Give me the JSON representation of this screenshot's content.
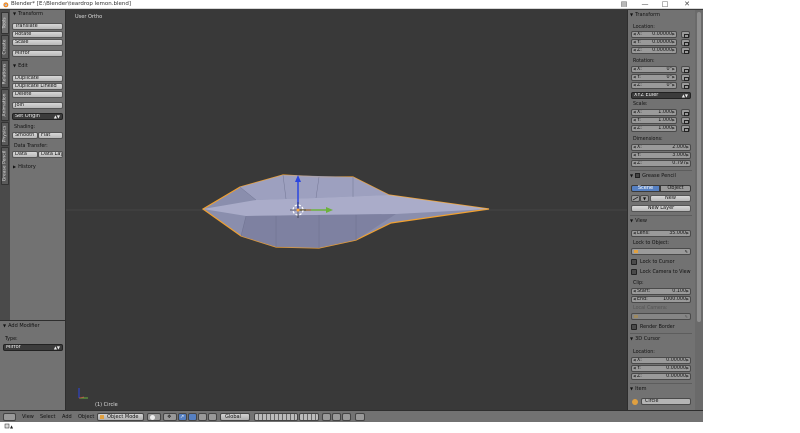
{
  "window": {
    "title": "Blender* [E:\\Blender\\teardrop lemon.blend]",
    "min_symbol": "—",
    "max_symbol": "□",
    "close_symbol": "✕"
  },
  "tool_tabs": [
    "Tools",
    "Create",
    "Relations",
    "Animation",
    "Physics",
    "Grease Pencil"
  ],
  "toolshelf": {
    "transform": {
      "title": "Transform",
      "buttons": [
        "Translate",
        "Rotate",
        "Scale",
        "Mirror"
      ]
    },
    "edit": {
      "title": "Edit",
      "buttons": [
        "Duplicate",
        "Duplicate Linked",
        "Delete",
        "Join"
      ],
      "set_origin": "Set Origin",
      "shading_label": "Shading:",
      "smooth": "Smooth",
      "flat": "Flat",
      "data_transfer_label": "Data Transfer:",
      "data": "Data",
      "data_layo": "Data Layo"
    },
    "history": {
      "title": "History"
    }
  },
  "last_operator": {
    "title": "Add Modifier",
    "type_label": "Type:",
    "type_value": "Mirror"
  },
  "viewport": {
    "view_label": "User Ortho",
    "object_label": "(1) Circle"
  },
  "header": {
    "menus": [
      "View",
      "Select",
      "Add",
      "Object"
    ],
    "mode": "Object Mode",
    "orientation": "Global"
  },
  "properties": {
    "transform": {
      "title": "Transform",
      "location_label": "Location:",
      "location": [
        {
          "axis": "X:",
          "value": "0.00000"
        },
        {
          "axis": "Y:",
          "value": "0.00000"
        },
        {
          "axis": "Z:",
          "value": "0.00000"
        }
      ],
      "rotation_label": "Rotation:",
      "rotation": [
        {
          "axis": "X:",
          "value": "0°"
        },
        {
          "axis": "Y:",
          "value": "0°"
        },
        {
          "axis": "Z:",
          "value": "0°"
        }
      ],
      "rotation_mode": "XYZ Euler",
      "scale_label": "Scale:",
      "scale": [
        {
          "axis": "X:",
          "value": "1.000"
        },
        {
          "axis": "Y:",
          "value": "1.000"
        },
        {
          "axis": "Z:",
          "value": "1.000"
        }
      ],
      "dimensions_label": "Dimensions:",
      "dimensions": [
        {
          "axis": "X:",
          "value": "2.000"
        },
        {
          "axis": "Y:",
          "value": "3.000"
        },
        {
          "axis": "Z:",
          "value": "0.797"
        }
      ]
    },
    "grease_pencil": {
      "title": "Grease Pencil",
      "scene": "Scene",
      "object": "Object",
      "new": "New",
      "new_layer": "New Layer"
    },
    "view": {
      "title": "View",
      "lens_label": "Lens:",
      "lens_value": "35.000",
      "lock_to_object_label": "Lock to Object:",
      "lock_to_cursor": "Lock to Cursor",
      "lock_camera": "Lock Camera to View",
      "clip_label": "Clip:",
      "clip_start_label": "Start:",
      "clip_start": "0.100",
      "clip_end_label": "End:",
      "clip_end": "1000.000",
      "local_camera_label": "Local Camera:",
      "render_border": "Render Border"
    },
    "cursor": {
      "title": "3D Cursor",
      "location_label": "Location:",
      "location": [
        {
          "axis": "X:",
          "value": "0.00000"
        },
        {
          "axis": "Y:",
          "value": "0.00000"
        },
        {
          "axis": "Z:",
          "value": "0.00000"
        }
      ]
    },
    "item": {
      "title": "Item",
      "name": "Circle"
    }
  },
  "colors": {
    "viewport_bg": "#393939",
    "panel_bg": "#727272",
    "selection_outline": "#f0a030",
    "mesh_face": "#8f93b2",
    "x_axis": "#c04848",
    "y_axis": "#6cb23c",
    "z_axis": "#2a45e0",
    "active_tab": "#5680c2"
  }
}
